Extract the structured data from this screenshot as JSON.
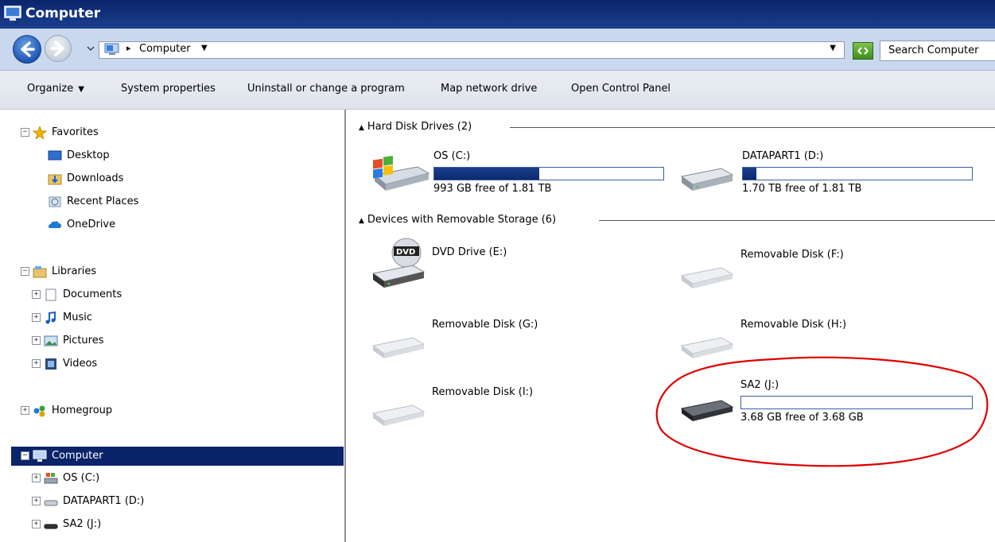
{
  "window": {
    "title": "Computer"
  },
  "address": {
    "breadcrumb": "Computer",
    "search_placeholder": "Search Computer"
  },
  "toolbar": {
    "organize": "Organize",
    "system_properties": "System properties",
    "uninstall": "Uninstall or change a program",
    "map_drive": "Map network drive",
    "control_panel": "Open Control Panel"
  },
  "sidebar": {
    "favorites": "Favorites",
    "desktop": "Desktop",
    "downloads": "Downloads",
    "recent": "Recent Places",
    "onedrive": "OneDrive",
    "libraries": "Libraries",
    "documents": "Documents",
    "music": "Music",
    "pictures": "Pictures",
    "videos": "Videos",
    "homegroup": "Homegroup",
    "computer": "Computer",
    "os_c": "OS (C:)",
    "datapart_d": "DATAPART1 (D:)",
    "sa2_j": "SA2 (J:)"
  },
  "main": {
    "hdd_header": "Hard Disk Drives (2)",
    "removable_header": "Devices with Removable Storage (6)",
    "drives": {
      "c": {
        "name": "OS (C:)",
        "free": "993 GB free of 1.81 TB",
        "used_fraction": 0.46
      },
      "d": {
        "name": "DATAPART1 (D:)",
        "free": "1.70 TB free of 1.81 TB",
        "used_fraction": 0.06
      },
      "e": {
        "name": "DVD Drive (E:)"
      },
      "f": {
        "name": "Removable Disk (F:)"
      },
      "g": {
        "name": "Removable Disk (G:)"
      },
      "h": {
        "name": "Removable Disk (H:)"
      },
      "i": {
        "name": "Removable Disk (I:)"
      },
      "j": {
        "name": "SA2 (J:)",
        "free": "3.68 GB free of 3.68 GB",
        "used_fraction": 0.0
      }
    }
  },
  "colors": {
    "titlebar": "#0a246a",
    "selection": "#0a246a",
    "drive_bar_fill": "#0a2a6e",
    "annotation": "#e00000"
  }
}
